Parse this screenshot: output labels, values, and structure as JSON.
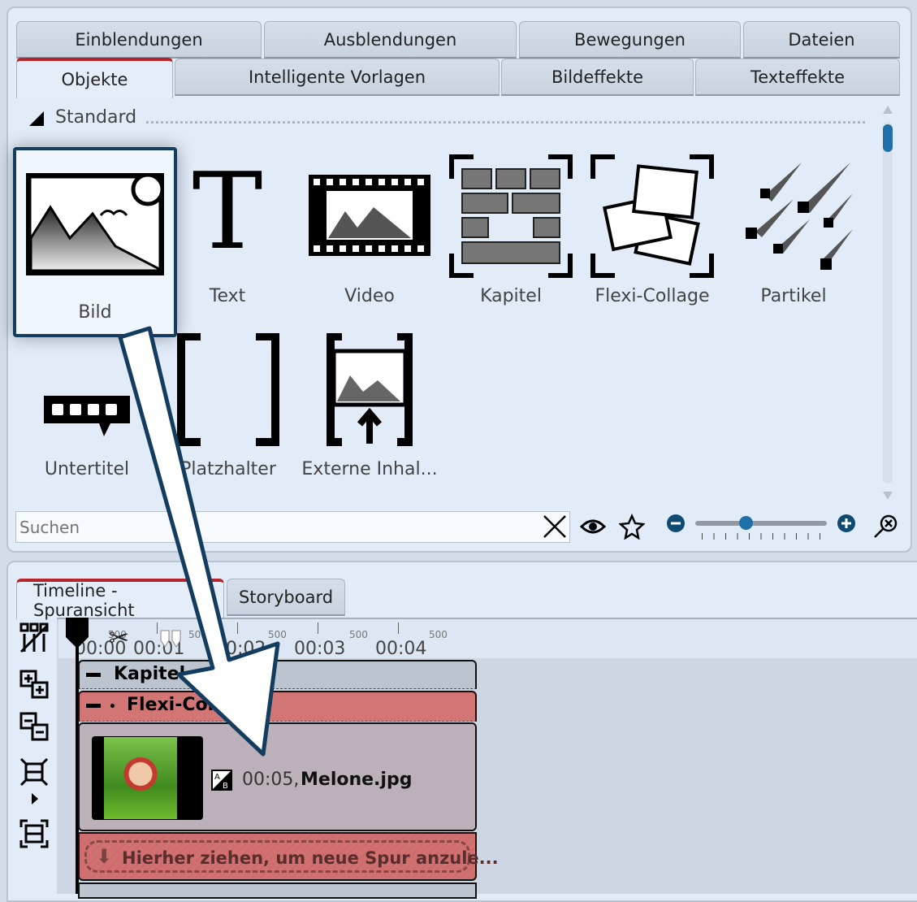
{
  "tabs_row1": [
    "Einblendungen",
    "Ausblendungen",
    "Bewegungen",
    "Dateien"
  ],
  "tabs_row2": [
    "Objekte",
    "Intelligente Vorlagen",
    "Bildeffekte",
    "Texteffekte"
  ],
  "active_tab": "Objekte",
  "section": "Standard",
  "objects": [
    "Bild",
    "Text",
    "Video",
    "Kapitel",
    "Flexi-Collage",
    "Partikel",
    "Untertitel",
    "Platzhalter",
    "Externe Inhal..."
  ],
  "search": {
    "placeholder": "Suchen",
    "value": ""
  },
  "zoom_slider": {
    "value": 0.38
  },
  "timeline": {
    "tabs": [
      "Timeline - Spuransicht",
      "Storyboard"
    ],
    "ruler": [
      "00:00",
      "00:01",
      "00:02",
      "00:03",
      "00:04"
    ],
    "ruler_sub": "500",
    "tracks": {
      "chapter": "Kapitel",
      "collage": "Flexi-Collage",
      "clip": "00:05,",
      "clip_name": "Melone.jpg",
      "drop": "Hierher ziehen, um neue Spur anzule..."
    }
  },
  "colors": {
    "accent": "#1f6fa8",
    "tab_active_line": "#b5262b",
    "arrow_outline": "#143c5e",
    "collage_track": "#d27575",
    "clip_bg": "#bcb0ba"
  }
}
